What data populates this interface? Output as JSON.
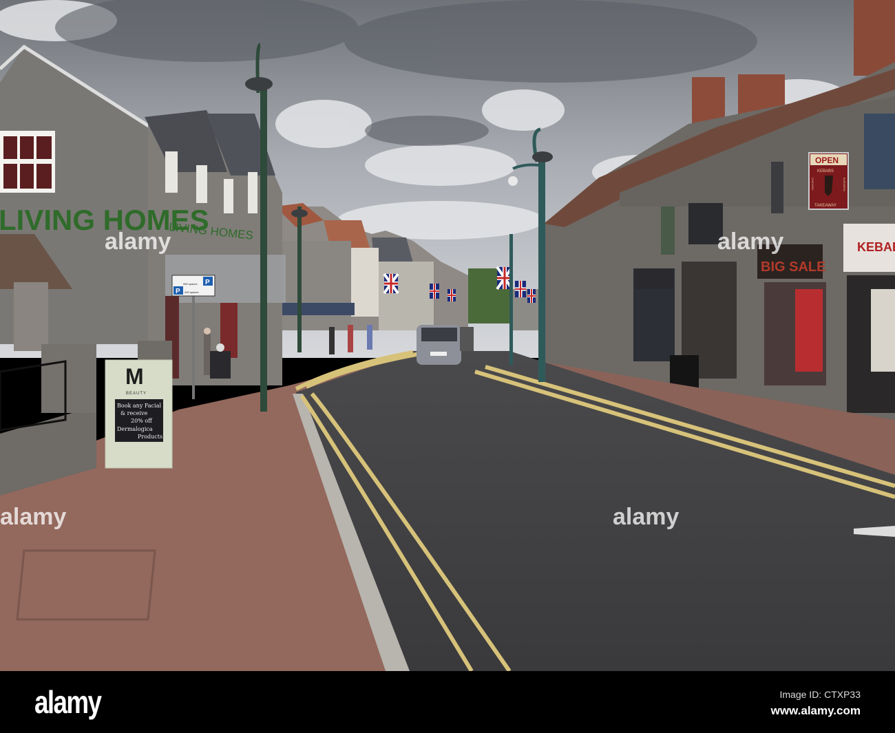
{
  "shop_signs": {
    "living_homes": "LIVING HOMES",
    "living_homes_side": "LIVING HOMES",
    "open": "OPEN",
    "kebabs": "KEBABS",
    "chicken": "CHICKEN",
    "burgers": "BURGERS",
    "takeaway": "TAKEAWAY",
    "kebab_house": "KEBAB",
    "big_sale": "BIG SALE"
  },
  "parking_sign": {
    "line1": "950 spaces",
    "line2": "200 spaces",
    "p": "P"
  },
  "a_board": {
    "logo": "M",
    "brand": "BEAUTY",
    "line1": "Book any Facial",
    "line2": "& receive",
    "line3": "20% off",
    "line4": "Dermalogica",
    "line5": "Products"
  },
  "watermark": "alamy",
  "footer": {
    "logo": "alamy",
    "image_id": "Image ID: CTXP33",
    "url": "www.alamy.com"
  }
}
